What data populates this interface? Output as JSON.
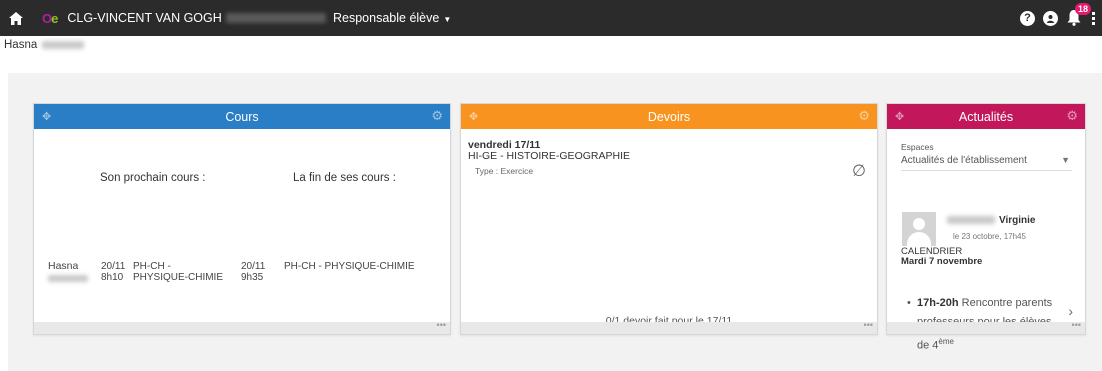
{
  "topbar": {
    "logo_o": "O",
    "logo_e": "e",
    "school": "CLG-VINCENT VAN GOGH",
    "role": "Responsable élève",
    "notifications": "18"
  },
  "user": {
    "first_name": "Hasna"
  },
  "widgets": {
    "cours": {
      "title": "Cours",
      "next_label": "Son prochain cours :",
      "end_label": "La fin de ses cours :",
      "student": "Hasna",
      "next": {
        "date": "20/11",
        "time": "8h10",
        "subject": "PH-CH - PHYSIQUE-CHIMIE"
      },
      "end": {
        "date": "20/11",
        "time": "9h35",
        "subject": "PH-CH - PHYSIQUE-CHIMIE"
      }
    },
    "devoirs": {
      "title": "Devoirs",
      "date": "vendredi 17/11",
      "subject": "HI-GE - HISTOIRE-GEOGRAPHIE",
      "type": "Type : Exercice",
      "summary": "0/1 devoir fait pour le 17/11"
    },
    "actualites": {
      "title": "Actualités",
      "espaces_label": "Espaces",
      "espace_selected": "Actualités de l'établissement",
      "author": "Virginie",
      "timestamp": "le 23 octobre, 17h45",
      "category": "CALENDRIER",
      "headline": "Mardi 7 novembre",
      "event_time": "17h-20h",
      "event_text": "Rencontre parents professeurs pour les élèves de 4",
      "event_sup": "ème"
    }
  },
  "colors": {
    "cours": "#2a7ec6",
    "devoirs": "#f7931e",
    "actualites": "#c2185b",
    "topbar": "#2b2b2b"
  },
  "icons": [
    "home-icon",
    "help-icon",
    "account-icon",
    "bell-icon",
    "more-vert-icon",
    "move-icon",
    "gear-icon",
    "empty-set-icon",
    "chevron-down-icon",
    "chevron-right-icon"
  ]
}
